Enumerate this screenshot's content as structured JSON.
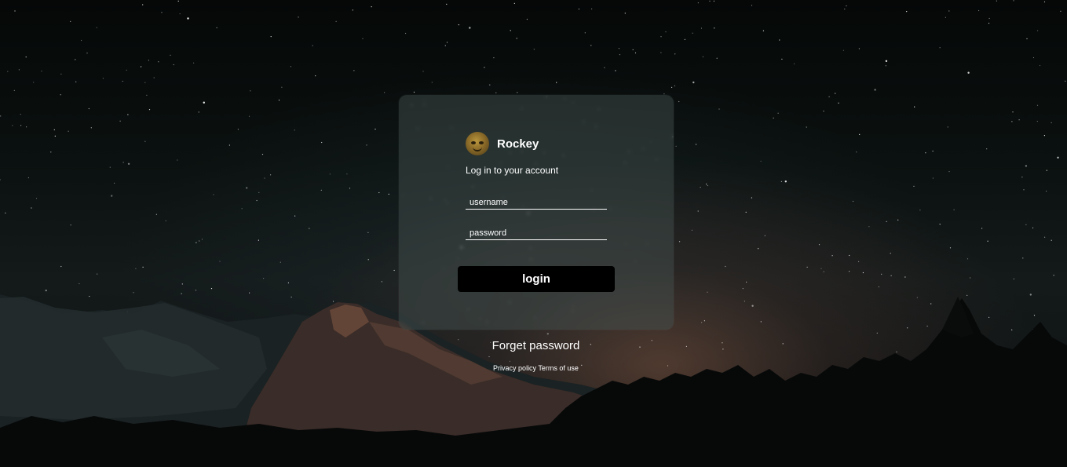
{
  "brand": {
    "name": "Rockey",
    "avatar_icon": "cartoon-face-avatar"
  },
  "login_form": {
    "subtitle": "Log in to your account",
    "username_placeholder": "username",
    "password_placeholder": "password",
    "submit_label": "login"
  },
  "links": {
    "forgot_password": "Forget password",
    "privacy_policy": "Privacy policy",
    "terms_of_use": "Terms of use"
  },
  "colors": {
    "button_bg": "#000000",
    "text": "#ffffff",
    "card_bg": "rgba(70,85,82,0.45)"
  }
}
